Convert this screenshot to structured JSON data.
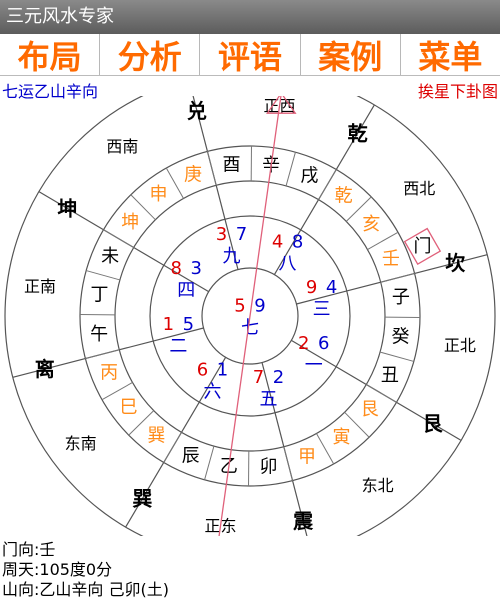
{
  "app": {
    "title": "三元风水专家"
  },
  "menu": [
    {
      "id": "buju",
      "label": "布局"
    },
    {
      "id": "fenxi",
      "label": "分析"
    },
    {
      "id": "pingyu",
      "label": "评语"
    },
    {
      "id": "anli",
      "label": "案例"
    },
    {
      "id": "caidan",
      "label": "菜单"
    }
  ],
  "subheader": {
    "left": "七运乙山辛向",
    "right": "挨星下卦图"
  },
  "colors": {
    "accent": "#ff6a00",
    "blue": "#0000cc",
    "red": "#dd0000",
    "star_red": "#dd0000",
    "star_blue": "#0000cc",
    "orange": "#ff8c1a"
  },
  "trigrams": [
    {
      "label": "兑",
      "angle": 0
    },
    {
      "label": "乾",
      "angle": 45
    },
    {
      "label": "坎",
      "angle": 90
    },
    {
      "label": "艮",
      "angle": 135
    },
    {
      "label": "震",
      "angle": 180
    },
    {
      "label": "巽",
      "angle": 225
    },
    {
      "label": "离",
      "angle": 270
    },
    {
      "label": "坤",
      "angle": 315
    }
  ],
  "directions": [
    {
      "label": "正西",
      "angle": -22.5
    },
    {
      "label": "西北",
      "angle": 22.5
    },
    {
      "label": "正北",
      "angle": 67.5
    },
    {
      "label": "东北",
      "angle": 112.5
    },
    {
      "label": "正东",
      "angle": 157.5
    },
    {
      "label": "东南",
      "angle": 202.5
    },
    {
      "label": "正南",
      "angle": 247.5
    },
    {
      "label": "西南",
      "angle": 292.5
    }
  ],
  "mountains": [
    {
      "label": "酉",
      "color": "black"
    },
    {
      "label": "辛",
      "color": "black"
    },
    {
      "label": "戌",
      "color": "black"
    },
    {
      "label": "乾",
      "color": "orange"
    },
    {
      "label": "亥",
      "color": "orange"
    },
    {
      "label": "壬",
      "color": "orange"
    },
    {
      "label": "子",
      "color": "black"
    },
    {
      "label": "癸",
      "color": "black"
    },
    {
      "label": "丑",
      "color": "black"
    },
    {
      "label": "艮",
      "color": "orange"
    },
    {
      "label": "寅",
      "color": "orange"
    },
    {
      "label": "甲",
      "color": "orange"
    },
    {
      "label": "卯",
      "color": "black"
    },
    {
      "label": "乙",
      "color": "black"
    },
    {
      "label": "辰",
      "color": "black"
    },
    {
      "label": "巽",
      "color": "orange"
    },
    {
      "label": "巳",
      "color": "orange"
    },
    {
      "label": "丙",
      "color": "orange"
    },
    {
      "label": "午",
      "color": "black"
    },
    {
      "label": "丁",
      "color": "black"
    },
    {
      "label": "未",
      "color": "black"
    },
    {
      "label": "坤",
      "color": "orange"
    },
    {
      "label": "申",
      "color": "orange"
    },
    {
      "label": "庚",
      "color": "orange"
    }
  ],
  "palaces": [
    {
      "angle": -22.5,
      "mountain": "3",
      "water": "7",
      "base": "九"
    },
    {
      "angle": 22.5,
      "mountain": "4",
      "water": "8",
      "base": "八"
    },
    {
      "angle": 67.5,
      "mountain": "9",
      "water": "4",
      "base": "三"
    },
    {
      "angle": 112.5,
      "mountain": "2",
      "water": "6",
      "base": "一"
    },
    {
      "angle": 157.5,
      "mountain": "7",
      "water": "2",
      "base": "五"
    },
    {
      "angle": 202.5,
      "mountain": "6",
      "water": "1",
      "base": "六"
    },
    {
      "angle": 247.5,
      "mountain": "1",
      "water": "5",
      "base": "二"
    },
    {
      "angle": 292.5,
      "mountain": "8",
      "water": "3",
      "base": "四"
    }
  ],
  "center": {
    "mountain": "5",
    "water": "9",
    "base": "七"
  },
  "door_label": "门",
  "footer": {
    "line1": "门向:壬",
    "line2": "周天:105度0分",
    "line3": "山向:乙山辛向 己卯(土)"
  }
}
